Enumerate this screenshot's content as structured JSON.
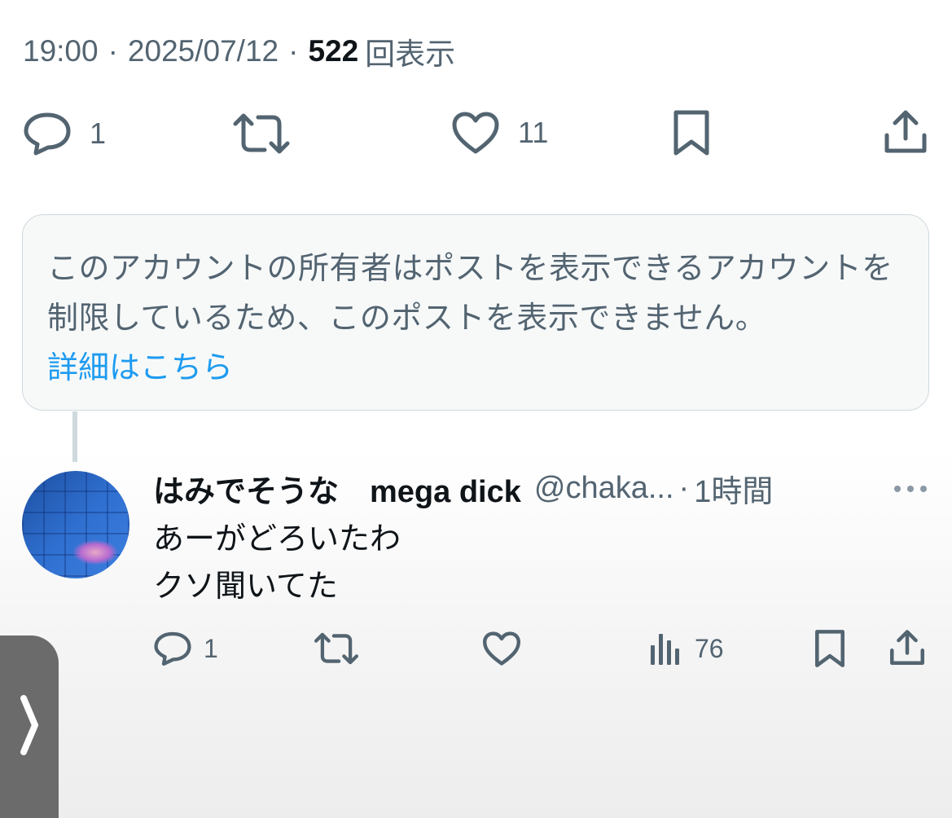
{
  "tweet": {
    "time": "19:00",
    "separator": "·",
    "date": "2025/07/12",
    "views_count": "522",
    "views_label": "回表示",
    "actions": {
      "replies": "1",
      "likes": "11"
    }
  },
  "notice": {
    "message": "このアカウントの所有者はポストを表示できるアカウントを制限しているため、このポストを表示できません。",
    "link": "詳細はこちら"
  },
  "reply": {
    "display_name": "はみでそうな　mega dick",
    "handle": "@chaka...",
    "separator": "·",
    "time": "1時間",
    "text_line1": "あーがどろいたわ",
    "text_line2": "クソ聞いてた",
    "actions": {
      "replies": "1",
      "views": "76"
    }
  },
  "colors": {
    "text_primary": "#0f1419",
    "text_secondary": "#536471",
    "link": "#1d9bf0",
    "border": "#cfd9de"
  },
  "icons": [
    "reply-icon",
    "retweet-icon",
    "like-icon",
    "bookmark-icon",
    "share-icon",
    "views-icon",
    "more-icon",
    "chevron-right-icon"
  ]
}
